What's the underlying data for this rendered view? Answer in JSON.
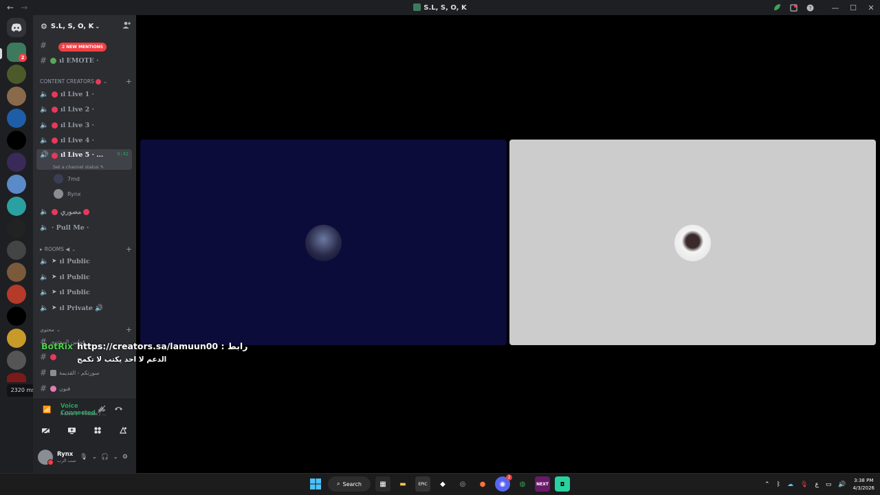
{
  "window": {
    "title": "S.L, S, O, K",
    "nav_back": "←",
    "nav_forward": "→",
    "tray_icons": [
      "leaf-icon",
      "inbox-icon",
      "help-icon"
    ],
    "controls": {
      "minimize": "—",
      "maximize": "☐",
      "close": "✕"
    }
  },
  "server_rail": {
    "latency": "2320 ms",
    "discord_home_icon": "discord-icon",
    "first_server_badge": "2"
  },
  "server": {
    "name": "S.L, S, O, K",
    "mentions_badge": "2 NEW MENTIONS"
  },
  "channels": {
    "text_top": [
      {
        "name": ""
      },
      {
        "name": "ıl EMOTE ·"
      }
    ],
    "categories": {
      "content_creators": "CONTENT CREATORS",
      "rooms": "ROOMS ◀",
      "content": "محتوى"
    },
    "creators": [
      {
        "name": "ıl Live 1 ·"
      },
      {
        "name": "ıl Live 2 ·"
      },
      {
        "name": "ıl Live 3 ·"
      },
      {
        "name": "ıl Live 4 ·"
      },
      {
        "name": "ıl Live 5 · ...",
        "time": "9:42",
        "status": "Set a channel status"
      }
    ],
    "voice_users": [
      {
        "name": "7md"
      },
      {
        "name": "Rynx"
      }
    ],
    "misc": [
      {
        "name": "مصوري"
      },
      {
        "name": "· Pull Me ·"
      }
    ],
    "rooms": [
      {
        "name": "ıl Public"
      },
      {
        "name": "ıl Public"
      },
      {
        "name": "ıl Public"
      },
      {
        "name": "ıl Private 🔊"
      }
    ],
    "content": [
      {
        "name": "قوانين المحتوى"
      },
      {
        "name": ""
      },
      {
        "name": "سورتكم - القديمة"
      },
      {
        "name": "فنون"
      }
    ]
  },
  "voice_panel": {
    "title": "Voice Connected",
    "subtitle": "ıl Live 5 · Private / ...",
    "actions": [
      "camera-off-icon",
      "screen-share-icon",
      "activities-icon",
      "soundboard-icon"
    ]
  },
  "user_panel": {
    "username": "Rynx",
    "status": "سب الرب"
  },
  "overlay": {
    "bot_name": "BotRix",
    "line1": "https://creators.sa/lamuun00 : رابط",
    "line2": "الدعم لا احد يكتب لا تكمج"
  },
  "taskbar": {
    "search_label": "Search",
    "discord_badge": "2",
    "time": "3:38 PM",
    "date": "4/3/2026",
    "lang": "ع"
  },
  "colors": {
    "online": "#23a55a",
    "danger": "#f23f43",
    "tile_left": "#0c0c3a",
    "tile_right": "#cccccc",
    "bot_green": "#4bd14b"
  }
}
